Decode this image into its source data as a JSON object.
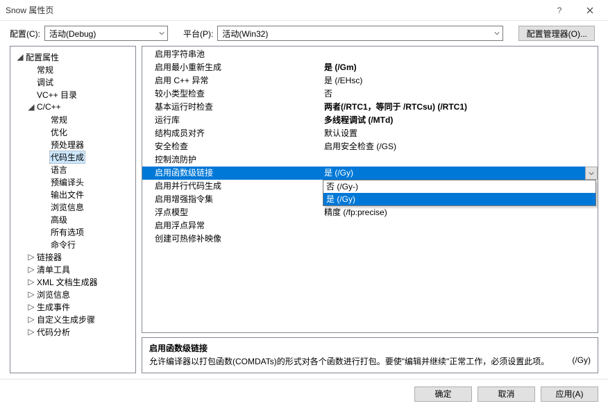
{
  "title": "Snow 属性页",
  "toprow": {
    "cfg_label": "配置(C):",
    "cfg_value": "活动(Debug)",
    "plat_label": "平台(P):",
    "plat_value": "活动(Win32)",
    "cfg_mgr": "配置管理器(O)..."
  },
  "tree": [
    {
      "lvl": 0,
      "toggle": "◢",
      "label": "配置属性"
    },
    {
      "lvl": 1,
      "toggle": "",
      "label": "常规"
    },
    {
      "lvl": 1,
      "toggle": "",
      "label": "调试"
    },
    {
      "lvl": 1,
      "toggle": "",
      "label": "VC++ 目录"
    },
    {
      "lvl": 1,
      "toggle": "◢",
      "label": "C/C++"
    },
    {
      "lvl": 2,
      "toggle": "",
      "label": "常规"
    },
    {
      "lvl": 2,
      "toggle": "",
      "label": "优化"
    },
    {
      "lvl": 2,
      "toggle": "",
      "label": "预处理器"
    },
    {
      "lvl": 2,
      "toggle": "",
      "label": "代码生成",
      "selected": true
    },
    {
      "lvl": 2,
      "toggle": "",
      "label": "语言"
    },
    {
      "lvl": 2,
      "toggle": "",
      "label": "预编译头"
    },
    {
      "lvl": 2,
      "toggle": "",
      "label": "输出文件"
    },
    {
      "lvl": 2,
      "toggle": "",
      "label": "浏览信息"
    },
    {
      "lvl": 2,
      "toggle": "",
      "label": "高级"
    },
    {
      "lvl": 2,
      "toggle": "",
      "label": "所有选项"
    },
    {
      "lvl": 2,
      "toggle": "",
      "label": "命令行"
    },
    {
      "lvl": 1,
      "toggle": "▷",
      "label": "链接器"
    },
    {
      "lvl": 1,
      "toggle": "▷",
      "label": "清单工具"
    },
    {
      "lvl": 1,
      "toggle": "▷",
      "label": "XML 文档生成器"
    },
    {
      "lvl": 1,
      "toggle": "▷",
      "label": "浏览信息"
    },
    {
      "lvl": 1,
      "toggle": "▷",
      "label": "生成事件"
    },
    {
      "lvl": 1,
      "toggle": "▷",
      "label": "自定义生成步骤"
    },
    {
      "lvl": 1,
      "toggle": "▷",
      "label": "代码分析"
    }
  ],
  "props": [
    {
      "k": "启用字符串池",
      "v": "",
      "bold": false
    },
    {
      "k": "启用最小重新生成",
      "v": "是 (/Gm)",
      "bold": true
    },
    {
      "k": "启用 C++ 异常",
      "v": "是 (/EHsc)",
      "bold": false
    },
    {
      "k": "较小类型检查",
      "v": "否",
      "bold": false
    },
    {
      "k": "基本运行时检查",
      "v": "两者(/RTC1，等同于 /RTCsu) (/RTC1)",
      "bold": true
    },
    {
      "k": "运行库",
      "v": "多线程调试 (/MTd)",
      "bold": true
    },
    {
      "k": "结构成员对齐",
      "v": "默认设置",
      "bold": false
    },
    {
      "k": "安全检查",
      "v": "启用安全检查 (/GS)",
      "bold": false
    },
    {
      "k": "控制流防护",
      "v": "",
      "bold": false
    },
    {
      "k": "启用函数级链接",
      "v": "是 (/Gy)",
      "bold": false,
      "selected": true
    },
    {
      "k": "启用并行代码生成",
      "v": "否 (/Gy-)",
      "bold": false
    },
    {
      "k": "启用增强指令集",
      "v": "是 (/Gy)",
      "bold": false,
      "dd_hover": true
    },
    {
      "k": "浮点模型",
      "v": "精度 (/fp:precise)",
      "bold": false
    },
    {
      "k": "启用浮点异常",
      "v": "",
      "bold": false
    },
    {
      "k": "创建可热修补映像",
      "v": "",
      "bold": false
    }
  ],
  "dropdown_options": [
    {
      "label": "否 (/Gy-)",
      "hover": false
    },
    {
      "label": "是 (/Gy)",
      "hover": true
    }
  ],
  "desc": {
    "title": "启用函数级链接",
    "body": "允许编译器以打包函数(COMDATs)的形式对各个函数进行打包。要使\"编辑并继续\"正常工作，必须设置此项。",
    "flag": "(/Gy)"
  },
  "buttons": {
    "ok": "确定",
    "cancel": "取消",
    "apply": "应用(A)"
  }
}
